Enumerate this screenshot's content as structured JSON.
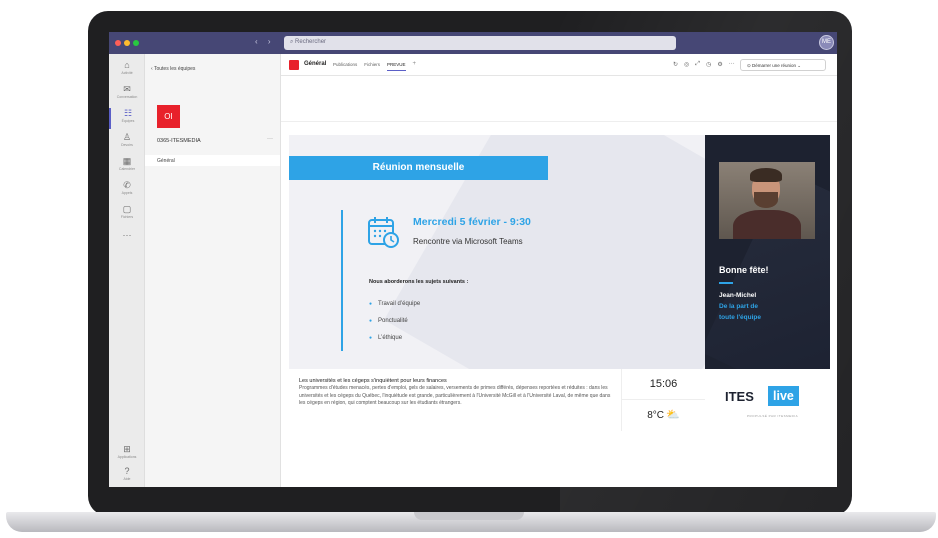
{
  "topbar": {
    "search_placeholder": "Rechercher",
    "nav_arrows": "‹ ›",
    "avatar_initials": "ME",
    "dots": [
      "#ff5f57",
      "#febc2e",
      "#28c840"
    ]
  },
  "rail": {
    "items": [
      {
        "icon": "⌂",
        "label": "Activité",
        "name": "rail-item-activity"
      },
      {
        "icon": "✉",
        "label": "Conversation",
        "name": "rail-item-chat"
      },
      {
        "icon": "☷",
        "label": "Équipes",
        "name": "rail-item-teams"
      },
      {
        "icon": "♙",
        "label": "Devoirs",
        "name": "rail-item-assignments"
      },
      {
        "icon": "▦",
        "label": "Calendrier",
        "name": "rail-item-calendar"
      },
      {
        "icon": "✆",
        "label": "Appels",
        "name": "rail-item-calls"
      },
      {
        "icon": "▢",
        "label": "Fichiers",
        "name": "rail-item-files"
      },
      {
        "icon": "···",
        "label": "",
        "name": "rail-item-more"
      }
    ],
    "bottom": [
      {
        "icon": "⊞",
        "label": "Applications",
        "name": "rail-item-apps"
      },
      {
        "icon": "?",
        "label": "Aide",
        "name": "rail-item-help"
      }
    ]
  },
  "channels": {
    "back_label": "‹  Toutes les équipes",
    "team_initials": "OI",
    "team_name": "0365-ITESMEDIA",
    "more": "···",
    "channel": "Général"
  },
  "header": {
    "channel_name": "Général",
    "tabs": [
      "Publications",
      "Fichiers",
      "PREVUE"
    ],
    "active_tab": "PREVUE",
    "add_tab": "+",
    "icons": [
      "↻",
      "◎",
      "⤢",
      "◷",
      "⚙",
      "···"
    ],
    "meet_label": "⊙  Démarrer une réunion  ⌄"
  },
  "slide": {
    "banner": "Réunion mensuelle",
    "event_date": "Mercredi 5 février - 9:30",
    "event_sub": "Rencontre via Microsoft Teams",
    "topics_title": "Nous aborderons les sujets suivants :",
    "topics": [
      "Travail d’équipe",
      "Ponctualité",
      "L’éthique"
    ],
    "bday": {
      "title": "Bonne fête!",
      "name": "Jean-Michel",
      "from_line1": "De la part de",
      "from_line2": "toute l'équipe"
    },
    "news": {
      "title": "Les universités et les cégeps s'inquiètent pour leurs finances",
      "body": "Programmes d'études menacés, pertes d'emploi, gels de salaires, versements de primes différés, dépenses reportées et réduites : dans les universités et les cégeps du Québec, l'inquiétude est grande, particulièrement à l'Université McGill et à l'Université Laval, de même que dans les cégeps en région, qui comptent beaucoup sur les étudiants étrangers."
    },
    "clock": "15:06",
    "weather": "8°C",
    "weather_icon": "partly-cloudy-icon",
    "brand": {
      "ites": "ITES",
      "live": "live",
      "tagline": "PROPULSÉ PAR ITESMEDIA"
    }
  },
  "colors": {
    "accent_blue": "#2ea3e6",
    "teams_purple": "#464775",
    "brand_red": "#e8212b",
    "dark_panel": "#1d2230"
  }
}
